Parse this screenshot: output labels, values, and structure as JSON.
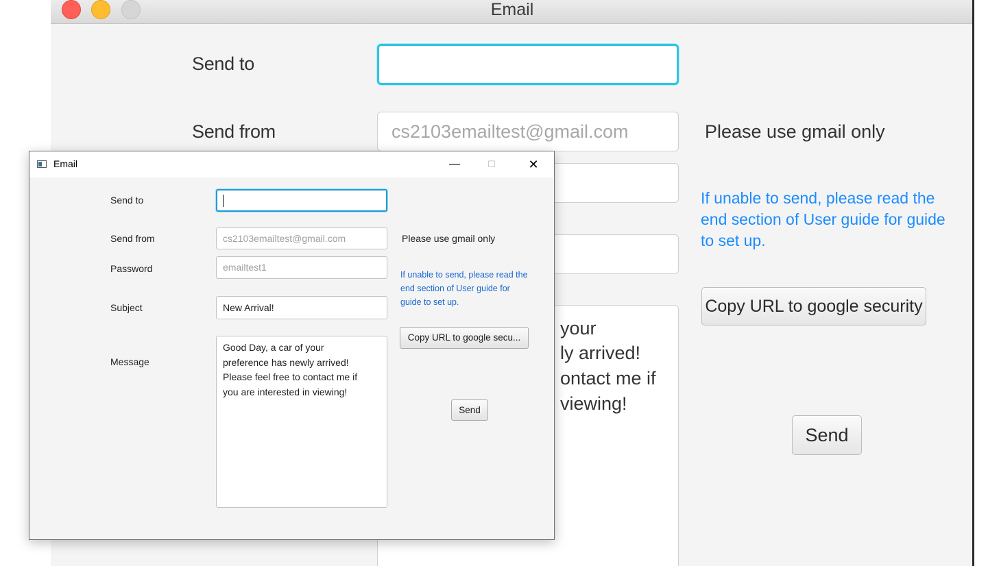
{
  "mac_window": {
    "title": "Email",
    "labels": {
      "send_to": "Send to",
      "send_from": "Send from"
    },
    "send_from_placeholder": "cs2103emailtest@gmail.com",
    "gmail_note": "Please use gmail only",
    "help_line1": "If unable to send, please read the",
    "help_line2": "end section of User guide for guide",
    "help_line3": "to set up.",
    "copy_url_button": "Copy URL to google security",
    "send_button": "Send",
    "message_fragments": [
      "your",
      "ly arrived!",
      "ontact me if",
      "viewing!"
    ]
  },
  "win_window": {
    "title": "Email",
    "controls": {
      "minimize": "—",
      "maximize": "☐",
      "close": "✕"
    },
    "labels": {
      "send_to": "Send to",
      "send_from": "Send from",
      "password": "Password",
      "subject": "Subject",
      "message": "Message"
    },
    "send_from_placeholder": "cs2103emailtest@gmail.com",
    "password_placeholder": "emailtest1",
    "subject_value": "New Arrival!",
    "message_lines": [
      "Good Day, a car of your",
      "preference has newly arrived!",
      "Please feel free to contact me if",
      "you are interested in viewing!"
    ],
    "gmail_note": "Please use gmail only",
    "help_line1": "If unable to send, please read the",
    "help_line2": "end section of User guide for",
    "help_line3": "guide to set up.",
    "copy_url_button": "Copy URL to google secu...",
    "send_button": "Send"
  }
}
